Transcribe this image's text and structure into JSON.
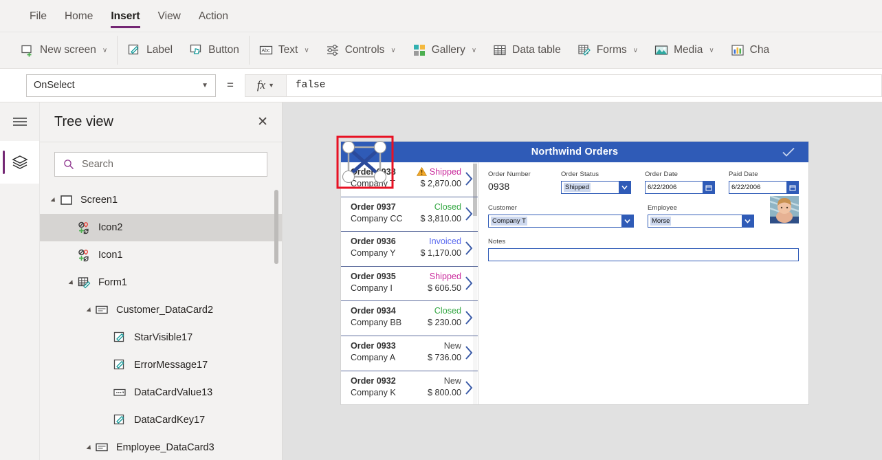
{
  "menubar": {
    "items": [
      {
        "label": "File",
        "active": false
      },
      {
        "label": "Home",
        "active": false
      },
      {
        "label": "Insert",
        "active": true
      },
      {
        "label": "View",
        "active": false
      },
      {
        "label": "Action",
        "active": false
      }
    ]
  },
  "ribbon": {
    "buttons": [
      {
        "label": "New screen",
        "icon": "new-screen-icon",
        "chevron": "∨"
      },
      {
        "label": "Label",
        "icon": "label-icon",
        "chevron": ""
      },
      {
        "label": "Button",
        "icon": "button-icon",
        "chevron": ""
      },
      {
        "label": "Text",
        "icon": "text-icon",
        "chevron": "∨"
      },
      {
        "label": "Controls",
        "icon": "controls-icon",
        "chevron": "∨"
      },
      {
        "label": "Gallery",
        "icon": "gallery-icon",
        "chevron": "∨"
      },
      {
        "label": "Data table",
        "icon": "data-table-icon",
        "chevron": ""
      },
      {
        "label": "Forms",
        "icon": "forms-icon",
        "chevron": "∨"
      },
      {
        "label": "Media",
        "icon": "media-icon",
        "chevron": "∨"
      },
      {
        "label": "Cha",
        "icon": "charts-icon",
        "chevron": ""
      }
    ]
  },
  "formula_bar": {
    "property": "OnSelect",
    "equals": "=",
    "fx_label": "fx",
    "value": "false"
  },
  "tree_panel": {
    "title": "Tree view",
    "close_label": "✕",
    "search_placeholder": "Search",
    "nodes": [
      {
        "label": "Screen1",
        "depth": 0,
        "icon": "screen-icon",
        "twisty": true,
        "selected": false
      },
      {
        "label": "Icon2",
        "depth": 1,
        "icon": "icon-control-icon",
        "twisty": false,
        "selected": true
      },
      {
        "label": "Icon1",
        "depth": 1,
        "icon": "icon-control-icon",
        "twisty": false,
        "selected": false
      },
      {
        "label": "Form1",
        "depth": 1,
        "icon": "form-icon",
        "twisty": true,
        "selected": false
      },
      {
        "label": "Customer_DataCard2",
        "depth": 2,
        "icon": "datacard-icon",
        "twisty": true,
        "selected": false
      },
      {
        "label": "StarVisible17",
        "depth": 3,
        "icon": "label-control-icon",
        "twisty": false,
        "selected": false
      },
      {
        "label": "ErrorMessage17",
        "depth": 3,
        "icon": "label-control-icon",
        "twisty": false,
        "selected": false
      },
      {
        "label": "DataCardValue13",
        "depth": 3,
        "icon": "dropdown-control-icon",
        "twisty": false,
        "selected": false
      },
      {
        "label": "DataCardKey17",
        "depth": 3,
        "icon": "label-control-icon",
        "twisty": false,
        "selected": false
      },
      {
        "label": "Employee_DataCard3",
        "depth": 2,
        "icon": "datacard-icon",
        "twisty": true,
        "selected": false
      }
    ]
  },
  "canvas": {
    "app": {
      "title": "Northwind Orders",
      "header_color": "#2f5bb7",
      "check_icon": "checkmark-icon"
    },
    "gallery": {
      "rows": [
        {
          "order": "Order 0938",
          "company": "Company T",
          "status": "Shipped",
          "status_color": "#c9299b",
          "amount": "$ 2,870.00",
          "warning": true
        },
        {
          "order": "Order 0937",
          "company": "Company CC",
          "status": "Closed",
          "status_color": "#36a845",
          "amount": "$ 3,810.00",
          "warning": false
        },
        {
          "order": "Order 0936",
          "company": "Company Y",
          "status": "Invoiced",
          "status_color": "#5b6bf0",
          "amount": "$ 1,170.00",
          "warning": false
        },
        {
          "order": "Order 0935",
          "company": "Company I",
          "status": "Shipped",
          "status_color": "#c9299b",
          "amount": "$ 606.50",
          "warning": false
        },
        {
          "order": "Order 0934",
          "company": "Company BB",
          "status": "Closed",
          "status_color": "#36a845",
          "amount": "$ 230.00",
          "warning": false
        },
        {
          "order": "Order 0933",
          "company": "Company A",
          "status": "New",
          "status_color": "#4a4a4a",
          "amount": "$ 736.00",
          "warning": false
        },
        {
          "order": "Order 0932",
          "company": "Company K",
          "status": "New",
          "status_color": "#4a4a4a",
          "amount": "$ 800.00",
          "warning": false
        }
      ]
    },
    "form": {
      "order_number_label": "Order Number",
      "order_number_value": "0938",
      "order_status_label": "Order Status",
      "order_status_value": "Shipped",
      "order_date_label": "Order Date",
      "order_date_value": "6/22/2006",
      "paid_date_label": "Paid Date",
      "paid_date_value": "6/22/2006",
      "customer_label": "Customer",
      "customer_value": "Company T",
      "employee_label": "Employee",
      "employee_value": "Morse",
      "notes_label": "Notes",
      "notes_value": "",
      "photo_alt": "employee-photo"
    },
    "selection": {
      "border_color": "#e81123",
      "handle_color": "#ffffff",
      "cross_color": "#2b4a9b"
    }
  }
}
